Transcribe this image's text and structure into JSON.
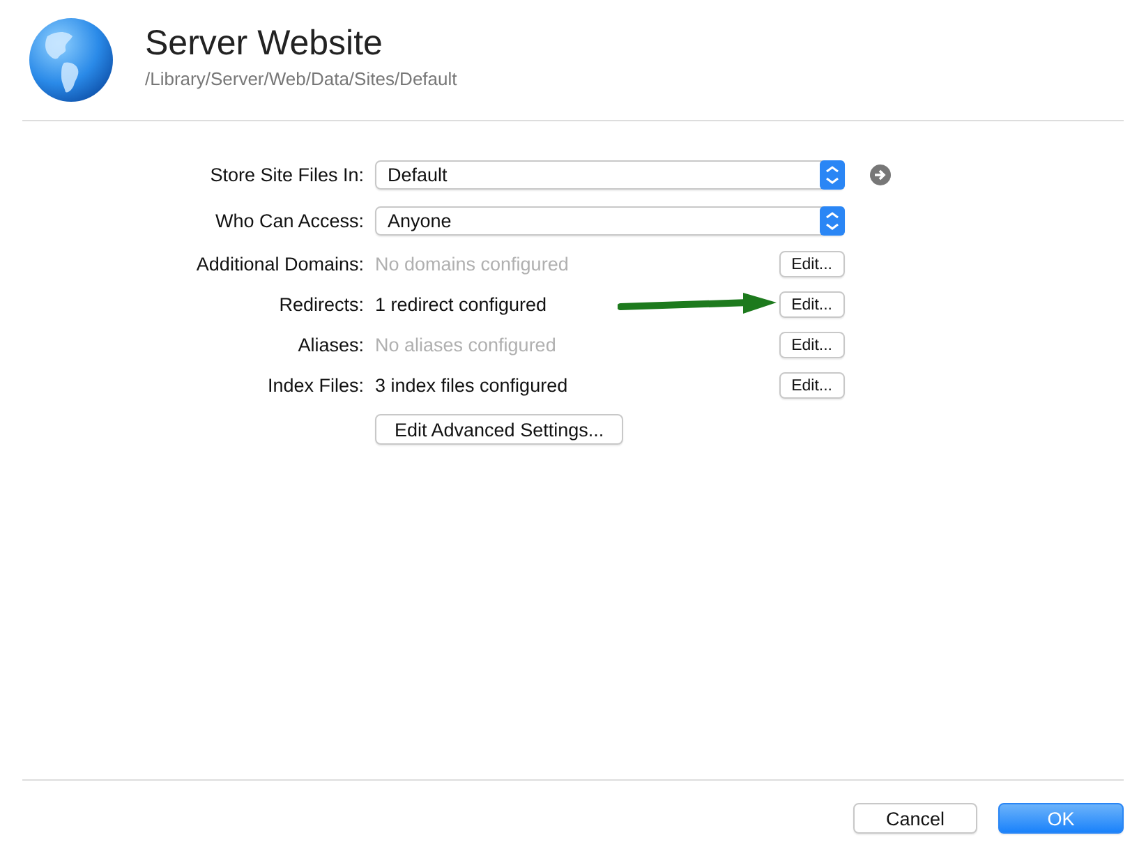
{
  "header": {
    "title": "Server Website",
    "path": "/Library/Server/Web/Data/Sites/Default"
  },
  "rows": [
    {
      "kind": "popup",
      "label": "Store Site Files In:",
      "value": "Default",
      "go_arrow": true
    },
    {
      "kind": "popup",
      "label": "Who Can Access:",
      "value": "Anyone",
      "go_arrow": false
    },
    {
      "kind": "info",
      "label": "Additional Domains:",
      "value": "No domains configured",
      "dimmed": true,
      "button": "Edit...",
      "annotated": false
    },
    {
      "kind": "info",
      "label": "Redirects:",
      "value": "1 redirect configured",
      "dimmed": false,
      "button": "Edit...",
      "annotated": true
    },
    {
      "kind": "info",
      "label": "Aliases:",
      "value": "No aliases configured",
      "dimmed": true,
      "button": "Edit...",
      "annotated": false
    },
    {
      "kind": "info",
      "label": "Index Files:",
      "value": "3 index files configured",
      "dimmed": false,
      "button": "Edit...",
      "annotated": false
    }
  ],
  "advanced_button": "Edit Advanced Settings...",
  "buttons": [
    {
      "label": "Cancel",
      "default": false
    },
    {
      "label": "OK",
      "default": true
    }
  ]
}
